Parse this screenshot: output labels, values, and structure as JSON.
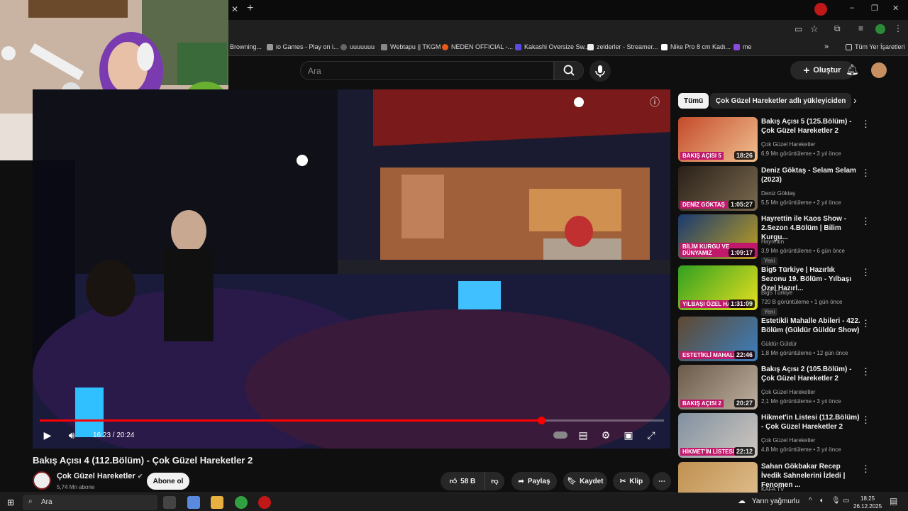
{
  "bookmarks": [
    {
      "label": "Browning...",
      "color": "#444"
    },
    {
      "label": "io Games - Play on i...",
      "color": "#999"
    },
    {
      "label": "uuuuuuu",
      "color": "#666"
    },
    {
      "label": "Webtapu || TKGM",
      "color": "#888"
    },
    {
      "label": "NEDEN OFFICIAL -...",
      "color": "#e85a1a"
    },
    {
      "label": "Kakashi Oversize Sw...",
      "color": "#5a4ae0"
    },
    {
      "label": "zelderler - Streamer...",
      "color": "#eee"
    },
    {
      "label": "Nike Pro 8 cm Kadı...",
      "color": "#fff"
    },
    {
      "label": "me",
      "color": "#8a4ae0"
    }
  ],
  "bookmarks_all": "Tüm Yer İşaretleri",
  "search": {
    "placeholder": "Ara"
  },
  "create_label": "Oluştur",
  "player": {
    "current_time": "16:23",
    "duration": "20:24",
    "time_text": "16:23 / 20:24",
    "progress": 0.803
  },
  "video": {
    "title": "Bakış Açısı 4 (112.Bölüm) - Çok Güzel Hareketler 2",
    "channel": "Çok Güzel Hareketler",
    "subs": "5,74 Mn abone",
    "subscribe": "Abone ol",
    "likes": "58 B",
    "share": "Paylaş",
    "save": "Kaydet",
    "clip": "Klip"
  },
  "chips": [
    "Tümü",
    "Çok Güzel Hareketler adlı yükleyiciden"
  ],
  "recommendations": [
    {
      "title": "Bakış Açısı 5 (125.Bölüm) - Çok Güzel Hareketler 2",
      "channel": "Çok Güzel Hareketler",
      "meta": "6,9 Mn görüntüleme • 3 yıl önce",
      "duration": "18:26",
      "thumb_text": "BAKIŞ AÇISI 5",
      "colors": [
        "#c44a2a",
        "#f0c090"
      ]
    },
    {
      "title": "Deniz Göktaş - Selam Selam (2023)",
      "channel": "Deniz Göktaş",
      "meta": "5,5 Mn görüntüleme • 2 yıl önce",
      "duration": "1:05:27",
      "thumb_text": "DENİZ GÖKTAŞ",
      "colors": [
        "#2a2018",
        "#7a6a50"
      ]
    },
    {
      "title": "Hayrettin ile Kaos Show - 2.Sezon 4.Bölüm | Bilim Kurgu...",
      "channel": "Hayrettin",
      "meta": "3,9 Mn görüntüleme • 6 gün önce",
      "duration": "1:09:17",
      "thumb_text": "BİLİM KURGU VE DÜNYAMIZ",
      "badge": "Yeni",
      "colors": [
        "#1a3a70",
        "#c0a020"
      ]
    },
    {
      "title": "Big5 Türkiye | Hazırlık Sezonu 19. Bölüm - Yılbaşı Özel Hazırl...",
      "channel": "Big5 Türkiye",
      "meta": "720 B görüntüleme • 1 gün önce",
      "duration": "1:31:09",
      "thumb_text": "YILBAŞI ÖZEL HAZIRL",
      "badge": "Yeni",
      "colors": [
        "#30a020",
        "#e8e020"
      ]
    },
    {
      "title": "Estetikli Mahalle Abileri - 422. Bölüm (Güldür Güldür Show)",
      "channel": "Güldür Güldür",
      "meta": "1,8 Mn görüntüleme • 12 gün önce",
      "duration": "22:46",
      "thumb_text": "ESTETİKLİ MAHALLE ABİ",
      "colors": [
        "#604830",
        "#3a80c0"
      ]
    },
    {
      "title": "Bakış Açısı 2 (105.Bölüm) - Çok Güzel Hareketler 2",
      "channel": "Çok Güzel Hareketler",
      "meta": "2,1 Mn görüntüleme • 3 yıl önce",
      "duration": "20:27",
      "thumb_text": "BAKIŞ AÇISI 2",
      "colors": [
        "#6a5a4a",
        "#c0b0a0"
      ]
    },
    {
      "title": "Hikmet'in Listesi (112.Bölüm) - Çok Güzel Hareketler 2",
      "channel": "Çok Güzel Hareketler",
      "meta": "4,8 Mn görüntüleme • 3 yıl önce",
      "duration": "22:12",
      "thumb_text": "HİKMET'İN LİSTESİ",
      "colors": [
        "#8090a0",
        "#d0c8c0"
      ]
    },
    {
      "title": "Sahan Gökbakar Recep İvedik Sahnelerini İzledi | Fenomen ...",
      "channel": "KAFA TV",
      "meta": "",
      "duration": "",
      "thumb_text": "",
      "colors": [
        "#c09050",
        "#e0c090"
      ]
    }
  ],
  "taskbar": {
    "search": "Ara",
    "weather": "Yarın yağmurlu",
    "time": "18:25",
    "date": "26.12.2025"
  }
}
